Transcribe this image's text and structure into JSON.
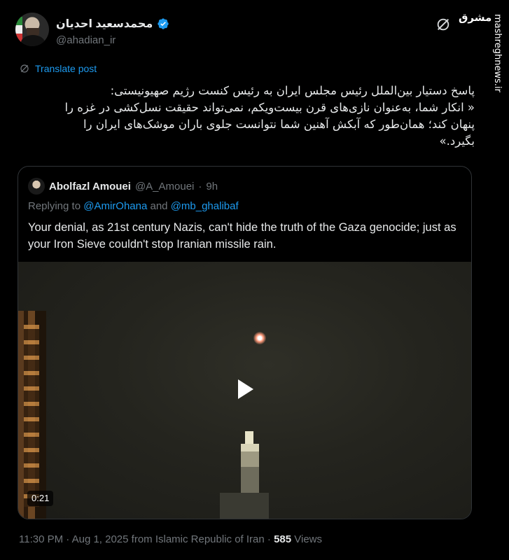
{
  "author": {
    "display_name": "محمدسعید احدیان",
    "handle": "@ahadian_ir"
  },
  "icons": {
    "verified": "verified-badge-icon",
    "grok": "grok-icon",
    "translate": "globe-translate-icon",
    "play": "play-icon"
  },
  "colors": {
    "accent": "#1d9bf0",
    "muted": "#71767b",
    "text": "#e7e9ea",
    "background": "#000000"
  },
  "watermark": {
    "logo": "مشرق",
    "site": "mashreghnews.ir"
  },
  "translate_label": "Translate post",
  "post_lines": [
    "پاسخ دستیار بین‌الملل رئیس مجلس ایران به رئیس کنست رژیم صهیونیستی:",
    "« انکار شما، به‌عنوان نازی‌های قرن بیست‌ویکم، نمی‌تواند حقیقت نسل‌کشی در غزه را",
    "پنهان کند؛ همان‌طور که آبکش آهنین شما نتوانست جلوی باران موشک‌های ایران را",
    "بگیرد.»"
  ],
  "quote": {
    "name": "Abolfazl Amouei",
    "handle": "@A_Amouei",
    "separator": "·",
    "time": "9h",
    "replying_prefix": "Replying to ",
    "mention_1": "@AmirOhana",
    "and": " and ",
    "mention_2": "@mb_ghalibaf",
    "text": "Your denial, as 21st century Nazis, can't hide the truth of the Gaza genocide; just as your Iron Sieve couldn't stop Iranian missile rain.",
    "video_duration": "0:21"
  },
  "meta": {
    "timestamp": "11:30 PM · Aug 1, 2025 from Islamic Republic of Iran · ",
    "views_count": "585",
    "views_label": " Views"
  }
}
